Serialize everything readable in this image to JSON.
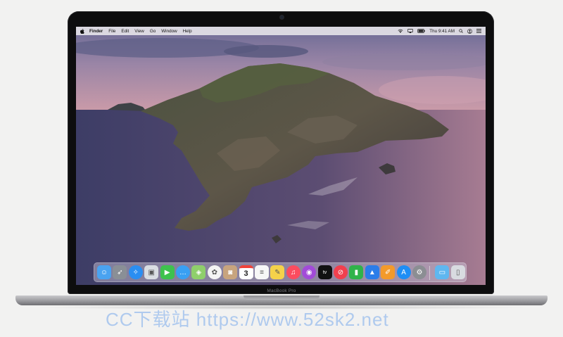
{
  "menubar": {
    "apple_icon": "apple-logo-icon",
    "menus": [
      "Finder",
      "File",
      "Edit",
      "View",
      "Go",
      "Window",
      "Help"
    ],
    "clock": "Thu 9:41 AM",
    "status_icons": [
      "wifi-icon",
      "airplay-icon",
      "battery-icon",
      "search-icon",
      "user-icon",
      "menu-list-icon"
    ]
  },
  "dock": {
    "apps": [
      {
        "name": "Finder",
        "icon": "finder-icon",
        "color": "#4aa3f0"
      },
      {
        "name": "Launchpad",
        "icon": "rocket-icon",
        "color": "#8a8f96"
      },
      {
        "name": "Safari",
        "icon": "compass-icon",
        "color": "#2a8ef2"
      },
      {
        "name": "Photo Viewer",
        "icon": "image-icon",
        "color": "#d9dde2"
      },
      {
        "name": "FaceTime",
        "icon": "video-icon",
        "color": "#3ec24e"
      },
      {
        "name": "Messages",
        "icon": "chat-icon",
        "color": "#39a0f3"
      },
      {
        "name": "Maps",
        "icon": "map-icon",
        "color": "#8fcf6b"
      },
      {
        "name": "Photos",
        "icon": "flower-icon",
        "color": "#f4f4f4"
      },
      {
        "name": "Contacts",
        "icon": "contacts-icon",
        "color": "#c8a47e"
      },
      {
        "name": "Calendar",
        "icon": "calendar-icon",
        "color": "#ffffff",
        "text": "3"
      },
      {
        "name": "Reminders",
        "icon": "list-icon",
        "color": "#f7f7f7"
      },
      {
        "name": "Notes",
        "icon": "note-icon",
        "color": "#f5d24a"
      },
      {
        "name": "Music",
        "icon": "music-icon",
        "color": "#fb4c5f"
      },
      {
        "name": "Podcasts",
        "icon": "podcast-icon",
        "color": "#a24bd8"
      },
      {
        "name": "TV",
        "icon": "tv-icon",
        "color": "#111111",
        "text": "tv"
      },
      {
        "name": "News",
        "icon": "news-icon",
        "color": "#f1404f"
      },
      {
        "name": "Numbers",
        "icon": "bar-chart-icon",
        "color": "#2fb34a"
      },
      {
        "name": "Keynote",
        "icon": "keynote-icon",
        "color": "#2b7de9"
      },
      {
        "name": "Pages",
        "icon": "pages-icon",
        "color": "#f39a2b"
      },
      {
        "name": "App Store",
        "icon": "appstore-icon",
        "color": "#1e8ef5"
      },
      {
        "name": "System Preferences",
        "icon": "gear-icon",
        "color": "#8b8e93"
      },
      {
        "name": "Downloads",
        "icon": "folder-icon",
        "color": "#5fb7ef"
      },
      {
        "name": "Trash",
        "icon": "trash-icon",
        "color": "#d8dbe0"
      }
    ]
  },
  "device": {
    "label": "MacBook Pro"
  },
  "watermark": {
    "text": "CC下载站 https://www.52sk2.net"
  }
}
